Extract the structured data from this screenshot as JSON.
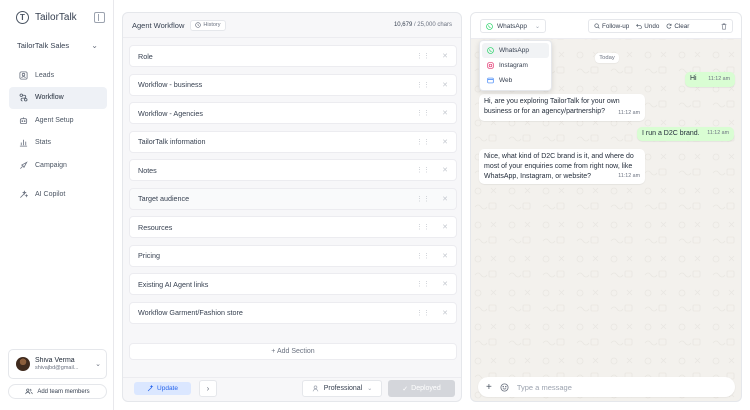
{
  "sidebar": {
    "brand": "TailorTalk",
    "brand_logo_letter": "T",
    "org": "TailorTalk Sales",
    "items": [
      {
        "label": "Leads",
        "icon": "leads-icon"
      },
      {
        "label": "Workflow",
        "icon": "workflow-icon",
        "active": true
      },
      {
        "label": "Agent Setup",
        "icon": "agent-setup-icon"
      },
      {
        "label": "Stats",
        "icon": "stats-icon"
      },
      {
        "label": "Campaign",
        "icon": "campaign-icon"
      },
      {
        "label": "AI Copilot",
        "icon": "ai-copilot-icon"
      }
    ],
    "user": {
      "name": "Shiva Verma",
      "email": "shivajbd@gmail..."
    },
    "add_team": "Add team members"
  },
  "workflow": {
    "title": "Agent Workflow",
    "history": "History",
    "chars_current": "10,679",
    "chars_limit": "/ 25,000 chars",
    "sections": [
      "Role",
      "Workflow - business",
      "Workflow - Agencies",
      "TailorTalk information",
      "Notes",
      "Target audience",
      "Resources",
      "Pricing",
      "Existing AI Agent links",
      "Workflow Garment/Fashion store"
    ],
    "add_section": "+ Add Section",
    "update": "Update",
    "tone": "Professional",
    "deployed": "Deployed"
  },
  "chat": {
    "channel": "WhatsApp",
    "channels": [
      "WhatsApp",
      "Instagram",
      "Web"
    ],
    "follow_up": "Follow-up",
    "undo": "Undo",
    "clear": "Clear",
    "day": "Today",
    "messages": [
      {
        "dir": "out",
        "text": "Hi",
        "time": "11:12 am"
      },
      {
        "dir": "in",
        "text": "Hi, are you exploring TailorTalk for your own business or for an agency/partnership?",
        "time": "11:12 am"
      },
      {
        "dir": "out",
        "text": "I run a D2C brand.",
        "time": "11:12 am"
      },
      {
        "dir": "in",
        "text": "Nice, what kind of D2C brand is it, and where do most of your enquiries come from right now, like WhatsApp, Instagram, or website?",
        "time": "11:12 am"
      }
    ],
    "composer_placeholder": "Type a message"
  },
  "colors": {
    "accent": "#2563eb",
    "update_bg": "#dbe7ff",
    "outgoing_bubble": "#d9fdd3",
    "whatsapp": "#25d366",
    "instagram": "#e1306c",
    "web": "#3b82f6"
  }
}
